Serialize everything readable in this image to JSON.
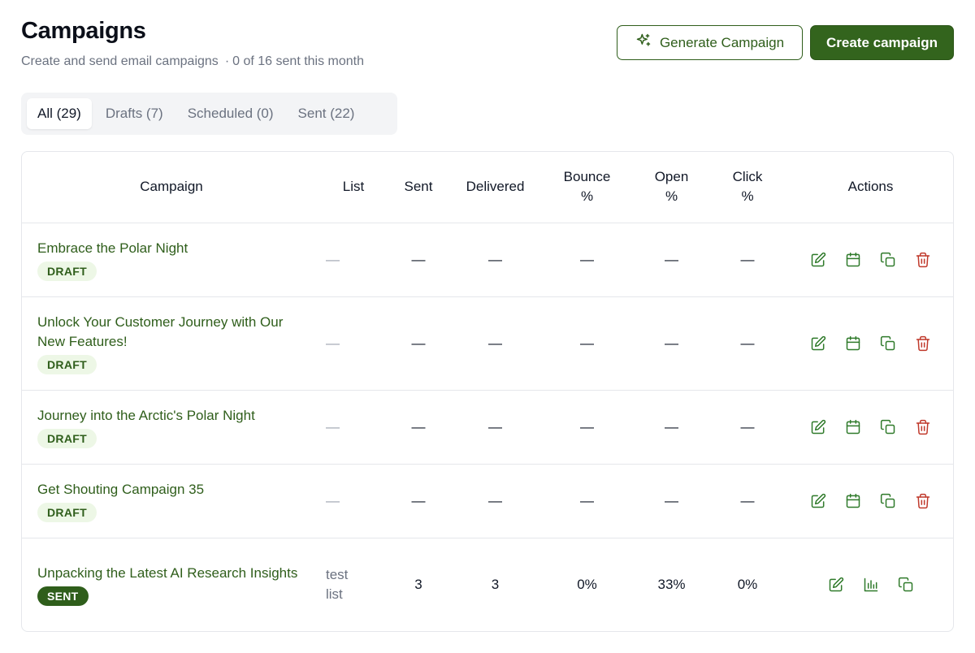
{
  "header": {
    "title": "Campaigns",
    "subtitle": "Create and send email campaigns",
    "separator": "·",
    "sent_count": "0 of 16 sent this month"
  },
  "toolbar": {
    "generate_label": "Generate Campaign",
    "create_label": "Create campaign"
  },
  "tabs": [
    {
      "label": "All (29)",
      "active": true
    },
    {
      "label": "Drafts (7)",
      "active": false
    },
    {
      "label": "Scheduled (0)",
      "active": false
    },
    {
      "label": "Sent (22)",
      "active": false
    }
  ],
  "table": {
    "headers": {
      "campaign": "Campaign",
      "list": "List",
      "sent": "Sent",
      "delivered": "Delivered",
      "bounce_1": "Bounce",
      "bounce_2": "%",
      "open_1": "Open",
      "open_2": "%",
      "click_1": "Click",
      "click_2": "%",
      "actions": "Actions"
    },
    "rows": [
      {
        "name": "Embrace the Polar Night",
        "status": "DRAFT",
        "list": "—",
        "sent": "—",
        "delivered": "—",
        "bounce": "—",
        "open": "—",
        "click": "—"
      },
      {
        "name": "Unlock Your Customer Journey with Our New Features!",
        "status": "DRAFT",
        "list": "—",
        "sent": "—",
        "delivered": "—",
        "bounce": "—",
        "open": "—",
        "click": "—"
      },
      {
        "name": "Journey into the Arctic's Polar Night",
        "status": "DRAFT",
        "list": "—",
        "sent": "—",
        "delivered": "—",
        "bounce": "—",
        "open": "—",
        "click": "—"
      },
      {
        "name": "Get Shouting Campaign 35",
        "status": "DRAFT",
        "list": "—",
        "sent": "—",
        "delivered": "—",
        "bounce": "—",
        "open": "—",
        "click": "—"
      },
      {
        "name": "Unpacking the Latest AI Research Insights",
        "status": "SENT",
        "list": "test list",
        "sent": "3",
        "delivered": "3",
        "bounce": "0%",
        "open": "33%",
        "click": "0%"
      }
    ]
  },
  "icons": {
    "generate": "sparkles-icon",
    "edit": "edit-icon",
    "schedule": "calendar-icon",
    "duplicate": "copy-icon",
    "delete": "trash-icon",
    "stats": "bar-chart-icon"
  },
  "colors": {
    "brand": "#33641d",
    "link_text": "#2f5e1b",
    "draft_badge_bg": "#edf7e6",
    "delete": "#c0392b"
  }
}
